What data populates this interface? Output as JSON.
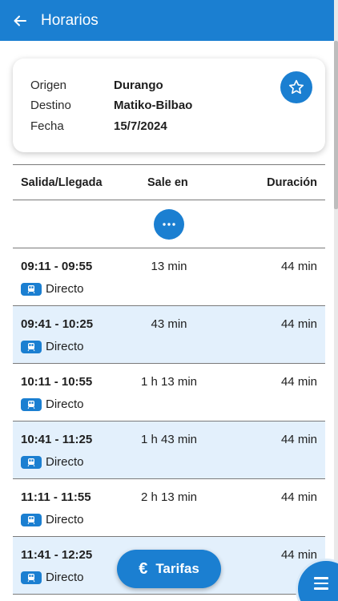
{
  "appbar": {
    "title": "Horarios",
    "back_icon": "arrow-left-icon"
  },
  "route": {
    "origin_label": "Origen",
    "origin": "Durango",
    "destination_label": "Destino",
    "destination": "Matiko-Bilbao",
    "date_label": "Fecha",
    "date": "15/7/2024",
    "favorite_icon": "star-outline-icon"
  },
  "table": {
    "headers": {
      "departure_arrival": "Salida/Llegada",
      "leaves_in": "Sale en",
      "duration": "Duración"
    },
    "more_icon": "more-horizontal-icon",
    "trips": [
      {
        "time": "09:11 - 09:55",
        "leaves_in": "13 min",
        "duration": "44 min",
        "type": "Directo"
      },
      {
        "time": "09:41 - 10:25",
        "leaves_in": "43 min",
        "duration": "44 min",
        "type": "Directo"
      },
      {
        "time": "10:11 - 10:55",
        "leaves_in": "1 h 13 min",
        "duration": "44 min",
        "type": "Directo"
      },
      {
        "time": "10:41 - 11:25",
        "leaves_in": "1 h 43 min",
        "duration": "44 min",
        "type": "Directo"
      },
      {
        "time": "11:11 - 11:55",
        "leaves_in": "2 h 13 min",
        "duration": "44 min",
        "type": "Directo"
      },
      {
        "time": "11:41 - 12:25",
        "leaves_in": "",
        "duration": "44 min",
        "type": "Directo"
      }
    ]
  },
  "fab": {
    "tarifas_label": "Tarifas",
    "euro_symbol": "€",
    "menu_icon": "menu-icon"
  },
  "colors": {
    "primary": "#1b7fd1",
    "row_alt": "#e3f0fc"
  }
}
